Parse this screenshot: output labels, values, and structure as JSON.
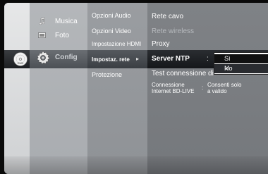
{
  "menu": {
    "main": [
      {
        "label": "Musica",
        "icon": "music-icon"
      },
      {
        "label": "Foto",
        "icon": "photo-icon"
      },
      {
        "label": "Config",
        "icon": "gear-icon"
      }
    ],
    "settings": [
      {
        "label": "Opzioni Audio"
      },
      {
        "label": "Opzioni Video"
      },
      {
        "label": "Impostazione HDMI"
      },
      {
        "label": "Impostaz. rete"
      },
      {
        "label": "Protezione"
      }
    ],
    "network": [
      {
        "label": "Rete cavo"
      },
      {
        "label": "Rete wireless"
      },
      {
        "label": "Proxy"
      },
      {
        "label": "Server NTP"
      },
      {
        "label": "Test connessione di"
      },
      {
        "label": "Connessione Internet BD-LIVE"
      }
    ],
    "submenu_arrow": "▸",
    "colon": ":",
    "bdlive_line1": "Connessione",
    "bdlive_line2": "Internet BD-LIVE",
    "bdlive_value_line1": "Consenti solo",
    "bdlive_value_line2": "a valido"
  },
  "dropdown": {
    "options": [
      "Sì",
      "No"
    ],
    "checked": "No",
    "check_glyph": "✓"
  },
  "disc_label": "DVD"
}
